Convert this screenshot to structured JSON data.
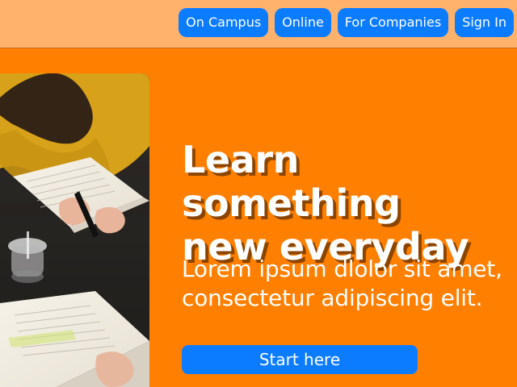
{
  "nav": {
    "items": [
      {
        "label": "On Campus"
      },
      {
        "label": "Online"
      },
      {
        "label": "For Companies"
      },
      {
        "label": "Sign In"
      }
    ]
  },
  "hero": {
    "title_line_1": "Learn something",
    "title_line_2": "new everyday",
    "subtitle_line_1": "Lorem ipsum dlolor sit amet,",
    "subtitle_line_2": "consectetur adipiscing elit.",
    "cta_label": "Start here",
    "image_icon": "study-photo-icon"
  },
  "colors": {
    "topbar": "#ffb26b",
    "hero_bg": "#ff7f00",
    "accent_blue": "#0b7cff",
    "text": "#ffffff"
  }
}
